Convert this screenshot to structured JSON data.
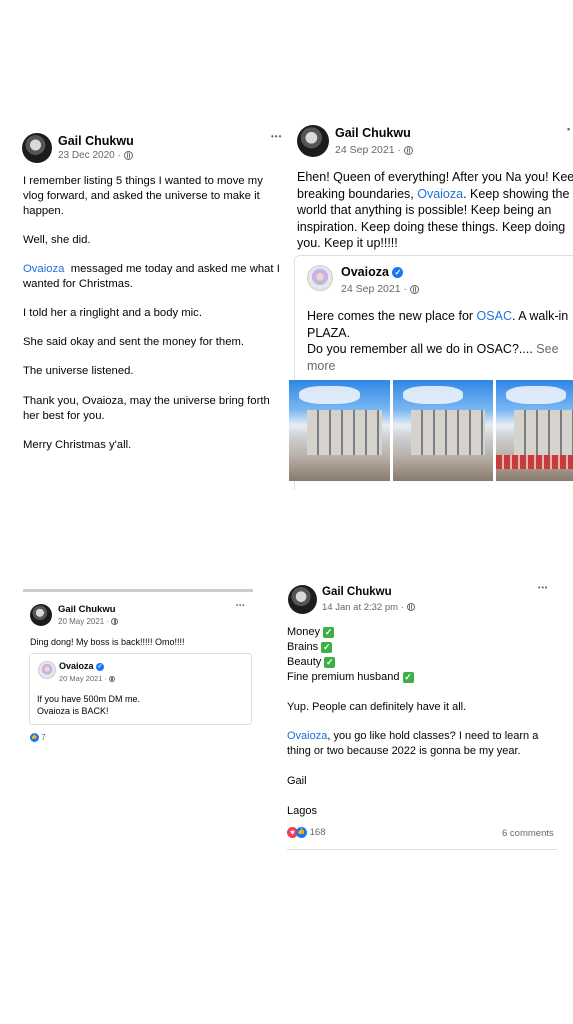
{
  "post1": {
    "author": "Gail Chukwu",
    "date": "23 Dec 2020",
    "more": "•••",
    "lines": [
      "I remember listing 5 things I wanted to move my",
      "vlog forward, and asked the universe to make it",
      "happen.",
      "Well, she did.",
      "messaged me today and asked me what I",
      "wanted for Christmas.",
      "I told her a ringlight and a body mic.",
      "She said okay and sent the money for them.",
      "The universe listened.",
      "Thank you, Ovaioza, may the universe bring forth",
      "her best for you.",
      "Merry Christmas y'all."
    ],
    "mention": "Ovaioza"
  },
  "post2": {
    "author": "Gail Chukwu",
    "date": "24 Sep 2021",
    "more": "•",
    "line1": "Ehen! Queen of everything! After you Na you! Keep",
    "line2a": "breaking boundaries,",
    "mention": "Ovaioza",
    "line2b": ". Keep showing the",
    "line3": "world that anything is possible! Keep being an",
    "line4": "inspiration. Keep doing these things. Keep doing",
    "line5": "you. Keep it up!!!!!",
    "shared": {
      "author": "Ovaioza",
      "date": "24 Sep 2021",
      "line1a": "Here comes the new place for",
      "osac": "OSAC",
      "line1b": ". A walk-in",
      "line2": "PLAZA.",
      "line3": "Do you remember all we do in OSAC?....",
      "see": "See",
      "more_link": "more"
    }
  },
  "post3": {
    "author": "Gail Chukwu",
    "date": "20 May 2021",
    "more": "•••",
    "text": "Ding dong! My boss is back!!!!!  Omo!!!!",
    "shared": {
      "author": "Ovaioza",
      "date": "20 May 2021",
      "line1": "If you have 500m DM me.",
      "line2": "Ovaioza is BACK!"
    },
    "reactions": "7"
  },
  "post4": {
    "author": "Gail Chukwu",
    "date": "14 Jan at 2:32 pm",
    "more": "•••",
    "list": [
      "Money",
      "Brains",
      "Beauty",
      "Fine premium husband"
    ],
    "line_yup": "Yup. People can definitely have it all.",
    "mention": "Ovaioza",
    "line_a": ", you go like hold classes? I need to learn a",
    "line_b": "thing or two because 2022 is gonna be my year.",
    "sign": "Gail",
    "place": "Lagos",
    "reactions": "168",
    "comments": "6 comments"
  },
  "icons": {
    "check": "✓",
    "like": "👍",
    "love": "♥"
  },
  "colors": {
    "link": "#216fdb",
    "verified": "#1877f2",
    "check": "#3cb043"
  }
}
